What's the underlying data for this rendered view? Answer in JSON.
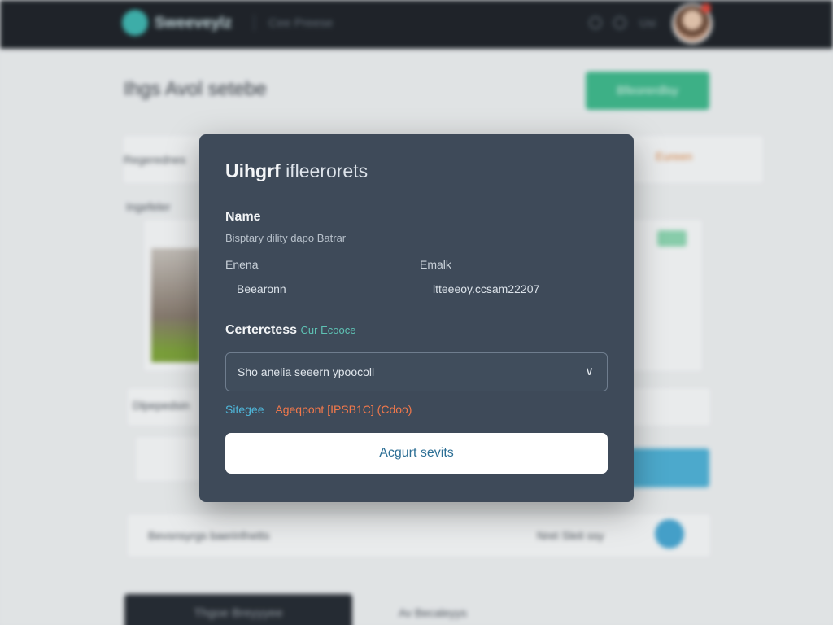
{
  "app": {
    "logo_text": "Sweeveylz",
    "nav_link": "Cee Preese",
    "user_label": "Usi"
  },
  "page": {
    "title": "Ihgs Avol setebe",
    "primary_action": "Bfeorerdlsy",
    "section_one_label": "Regerednes",
    "section_two_label": "Ingefeler",
    "section_three_label": "Dlpepedsin",
    "row_text": "Bevsnsyrgs baerinfnetts",
    "row_meta": "Nret Sleit ssy",
    "side_accent": "Eureen",
    "footer_button": "Thgoe Breyyyee",
    "footer_link": "Av Becaleyys"
  },
  "modal": {
    "title_bold": "Uihgrf",
    "title_rest": "ifleerorets",
    "name_section": "Name",
    "name_subtitle": "Bisptary dility dapo Batrar",
    "field_left_label": "Enena",
    "field_left_value": "Beearonn",
    "field_right_label": "Emalk",
    "field_right_value": "ltteeeoy.ccsam22207",
    "select_section": "Certerctess",
    "select_hint": "Cur Ecooce",
    "select_value": "Sho anelia seeern ypoocoll",
    "status_key": "Sitegee",
    "status_value": "Ageqpont [IPSB1C] (Cdoo)",
    "primary_button": "Acgurt sevits"
  }
}
